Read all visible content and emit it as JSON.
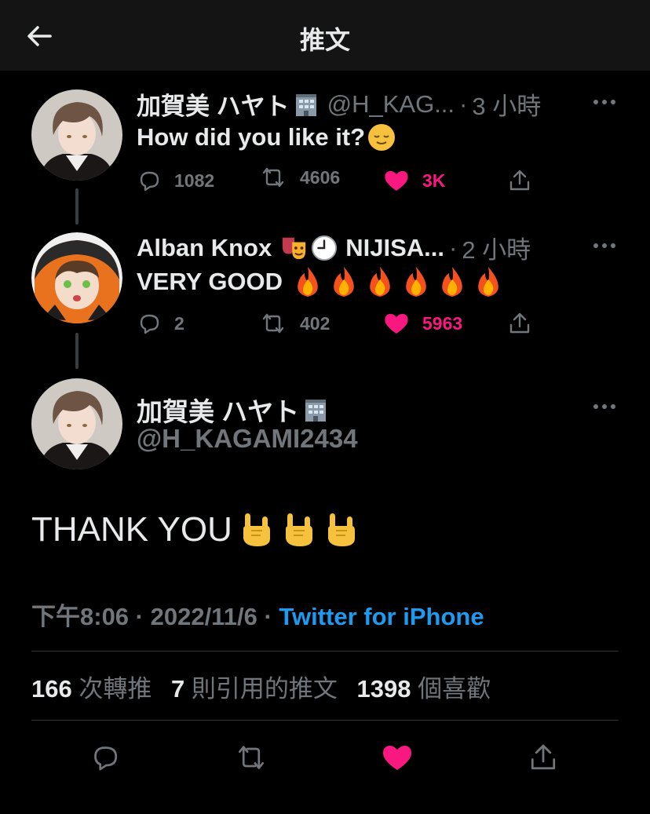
{
  "header": {
    "title": "推文",
    "back_icon": "arrow-left-icon"
  },
  "thread": [
    {
      "name": "加賀美 ハヤト",
      "badge_icon": "office-building-icon",
      "handle": "@H_KAG...",
      "separator": "·",
      "time": "3 小時",
      "text": "How did you like it?",
      "text_emoji": "relieved-face-icon",
      "counts": {
        "reply": "1082",
        "retweet": "4606",
        "like": "3K"
      },
      "liked": true
    },
    {
      "name": "Alban Knox",
      "badge_icons": [
        "performing-arts-icon",
        "clock-icon"
      ],
      "name_suffix": "NIJISA...",
      "handle": "",
      "separator": "·",
      "time": "2 小時",
      "text": "VERY GOOD",
      "text_emoji": "fire-icon",
      "text_emoji_count": 6,
      "counts": {
        "reply": "2",
        "retweet": "402",
        "like": "5963"
      },
      "liked": true
    }
  ],
  "main_tweet": {
    "name": "加賀美 ハヤト",
    "badge_icon": "office-building-icon",
    "handle": "@H_KAGAMI2434",
    "text": "THANK YOU",
    "text_emoji": "sign-of-the-horns-icon",
    "text_emoji_count": 3,
    "time": "下午8:06",
    "date": "2022/11/6",
    "source": "Twitter for iPhone",
    "stats": {
      "retweets_num": "166",
      "retweets_label": "次轉推",
      "quotes_num": "7",
      "quotes_label": "則引用的推文",
      "likes_num": "1398",
      "likes_label": "個喜歡"
    },
    "liked": true
  },
  "colors": {
    "background": "#000000",
    "header_bg": "#141414",
    "text": "#e7e9ea",
    "secondary": "#71767b",
    "link": "#1d9bf0",
    "like": "#f91880",
    "divider": "#2f3336"
  }
}
